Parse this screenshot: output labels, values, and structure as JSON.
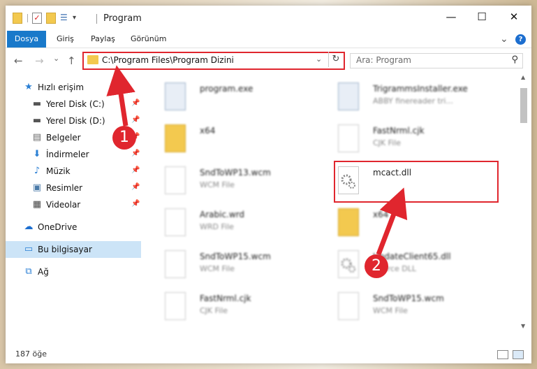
{
  "window": {
    "title": "Program",
    "minimize_glyph": "—",
    "maximize_glyph": "☐",
    "close_glyph": "✕"
  },
  "ribbon": {
    "tabs": [
      "Dosya",
      "Giriş",
      "Paylaş",
      "Görünüm"
    ],
    "collapse_glyph": "⌄",
    "help_glyph": "?"
  },
  "navigation": {
    "back_glyph": "←",
    "forward_glyph": "→",
    "recent_glyph": "⌄",
    "up_glyph": "↑"
  },
  "address": {
    "path": "C:\\Program Files\\Program Dizini",
    "dropdown_glyph": "⌄",
    "refresh_glyph": "↻"
  },
  "search": {
    "placeholder": "Ara: Program",
    "icon_glyph": "⚲"
  },
  "sidebar": {
    "items": [
      {
        "label": "Hızlı erişim",
        "icon": "star-icon",
        "glyph": "★",
        "color": "#2a7fd4"
      },
      {
        "label": "Yerel Disk (C:)",
        "icon": "drive-icon",
        "glyph": "▬",
        "color": "#555555",
        "pinned": true
      },
      {
        "label": "Yerel Disk (D:)",
        "icon": "drive-icon",
        "glyph": "▬",
        "color": "#555555",
        "pinned": true
      },
      {
        "label": "Belgeler",
        "icon": "document-icon",
        "glyph": "▤",
        "color": "#6a6a6a",
        "pinned": true
      },
      {
        "label": "İndirmeler",
        "icon": "download-icon",
        "glyph": "⬇",
        "color": "#2a7fd4",
        "pinned": true
      },
      {
        "label": "Müzik",
        "icon": "music-icon",
        "glyph": "♪",
        "color": "#2a7fd4",
        "pinned": true
      },
      {
        "label": "Resimler",
        "icon": "pictures-icon",
        "glyph": "▣",
        "color": "#4a7aa8",
        "pinned": true
      },
      {
        "label": "Videolar",
        "icon": "video-icon",
        "glyph": "▦",
        "color": "#444444",
        "pinned": true
      },
      {
        "label": "OneDrive",
        "icon": "cloud-icon",
        "glyph": "☁",
        "color": "#1c6ecf"
      },
      {
        "label": "Bu bilgisayar",
        "icon": "computer-icon",
        "glyph": "▭",
        "color": "#2a7fd4",
        "selected": true
      },
      {
        "label": "Ağ",
        "icon": "network-icon",
        "glyph": "⧉",
        "color": "#2a7fd4"
      }
    ],
    "pin_glyph": "📌"
  },
  "files": [
    {
      "name": "program.exe",
      "type": "",
      "kind": "exe",
      "blurred": true
    },
    {
      "name": "TrigrammsInstaller.exe",
      "type": "ABBY finereader tri...",
      "kind": "exe",
      "blurred": true
    },
    {
      "name": "x64",
      "type": "",
      "kind": "folder",
      "blurred": true
    },
    {
      "name": "FastNrml.cjk",
      "type": "CJK File",
      "kind": "doc",
      "blurred": true
    },
    {
      "name": "SndToWP13.wcm",
      "type": "WCM File",
      "kind": "doc",
      "blurred": true
    },
    {
      "name": "mcact.dll",
      "type": "",
      "kind": "dll",
      "blurred": false
    },
    {
      "name": "Arabic.wrd",
      "type": "WRD File",
      "kind": "doc",
      "blurred": true
    },
    {
      "name": "x64",
      "type": "",
      "kind": "folder",
      "blurred": true
    },
    {
      "name": "SndToWP15.wcm",
      "type": "WCM File",
      "kind": "doc",
      "blurred": true
    },
    {
      "name": "UpdateClient65.dll",
      "type": "Source DLL",
      "kind": "dll",
      "blurred": true
    },
    {
      "name": "FastNrml.cjk",
      "type": "CJK File",
      "kind": "doc",
      "blurred": true
    },
    {
      "name": "SndToWP15.wcm",
      "type": "WCM File",
      "kind": "doc",
      "blurred": true
    }
  ],
  "status": {
    "count": "187 öğe"
  },
  "annotations": {
    "step1": "1",
    "step2": "2",
    "color": "#e0262e"
  }
}
